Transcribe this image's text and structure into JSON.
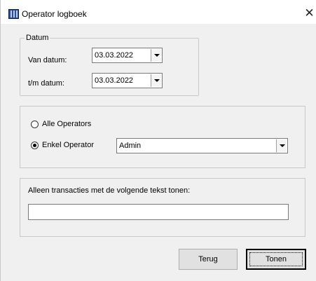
{
  "window": {
    "title": "Operator logboek",
    "close_glyph": "✕"
  },
  "datum": {
    "legend": "Datum",
    "from_label": "Van datum:",
    "from_value": "03.03.2022",
    "to_label": "t/m datum:",
    "to_value": "03.03.2022"
  },
  "operators": {
    "all_label": "Alle Operators",
    "single_label": "Enkel Operator",
    "selected": "single",
    "operator_value": "Admin"
  },
  "filter": {
    "label": "Alleen transacties met de volgende tekst tonen:",
    "value": ""
  },
  "buttons": {
    "back": "Terug",
    "show": "Tonen"
  }
}
